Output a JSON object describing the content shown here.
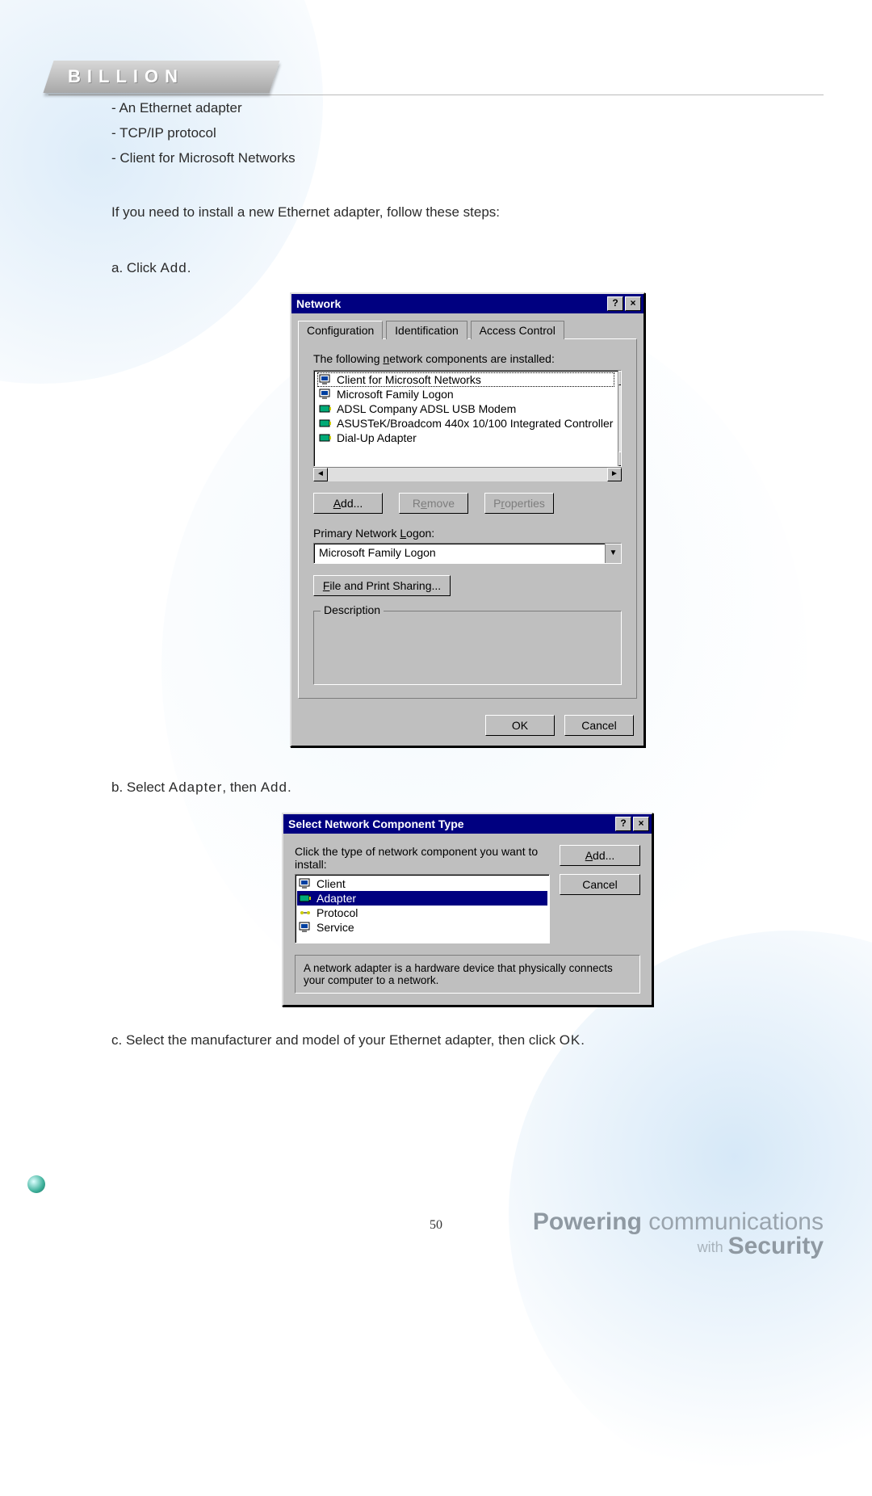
{
  "logo_text": "BILLION",
  "bullets": [
    "- An Ethernet adapter",
    "- TCP/IP protocol",
    "- Client for Microsoft Networks"
  ],
  "intro": "If you need to install a new Ethernet adapter, follow these steps:",
  "step_a_prefix": "a. Click ",
  "step_a_action": "Add",
  "step_a_suffix": ".",
  "step_b_prefix": "b. Select ",
  "step_b_action1": "Adapter",
  "step_b_mid": ", then ",
  "step_b_action2": "Add",
  "step_b_suffix": ".",
  "step_c_prefix": "c. Select the manufacturer and model of your Ethernet adapter, then click ",
  "step_c_action": "OK",
  "step_c_suffix": ".",
  "network_dialog": {
    "title": "Network",
    "tabs": [
      "Configuration",
      "Identification",
      "Access Control"
    ],
    "installed_label": "The following network components are installed:",
    "components": [
      "Client for Microsoft Networks",
      "Microsoft Family Logon",
      "ADSL Company ADSL USB Modem",
      "ASUSTeK/Broadcom 440x 10/100 Integrated Controller",
      "Dial-Up Adapter"
    ],
    "add_btn": "Add...",
    "remove_btn": "Remove",
    "properties_btn": "Properties",
    "primary_logon_label": "Primary Network Logon:",
    "primary_logon_value": "Microsoft Family Logon",
    "file_print_btn": "File and Print Sharing...",
    "description_label": "Description",
    "ok_btn": "OK",
    "cancel_btn": "Cancel"
  },
  "component_dialog": {
    "title": "Select Network Component Type",
    "prompt": "Click the type of network component you want to install:",
    "items": [
      "Client",
      "Adapter",
      "Protocol",
      "Service"
    ],
    "selected": "Adapter",
    "add_btn": "Add...",
    "cancel_btn": "Cancel",
    "description": "A network adapter is a hardware device that physically connects your computer to a network."
  },
  "page_number": "50",
  "footer": {
    "powering": "Powering",
    "communications": "communications",
    "with": "with",
    "security": "Security"
  }
}
